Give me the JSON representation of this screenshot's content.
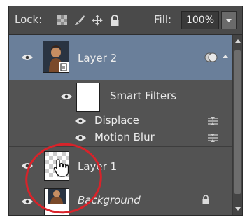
{
  "topbar": {
    "lock_label": "Lock:",
    "fill_label": "Fill:",
    "fill_value": "100%"
  },
  "layers": {
    "layer2": {
      "name": "Layer 2"
    },
    "smart_filters": {
      "label": "Smart Filters"
    },
    "filters": [
      {
        "name": "Displace"
      },
      {
        "name": "Motion Blur"
      }
    ],
    "layer1": {
      "name": "Layer 1"
    },
    "background": {
      "name": "Background"
    }
  },
  "colors": {
    "selected_row": "#6a7f9a",
    "annotation": "#d8232a",
    "panel": "#535353"
  },
  "icons": [
    "eye-icon",
    "lock-transparent-icon",
    "lock-paint-icon",
    "lock-move-icon",
    "lock-all-icon",
    "smart-object-badge-icon",
    "filter-options-icon",
    "hand-cursor-icon"
  ]
}
